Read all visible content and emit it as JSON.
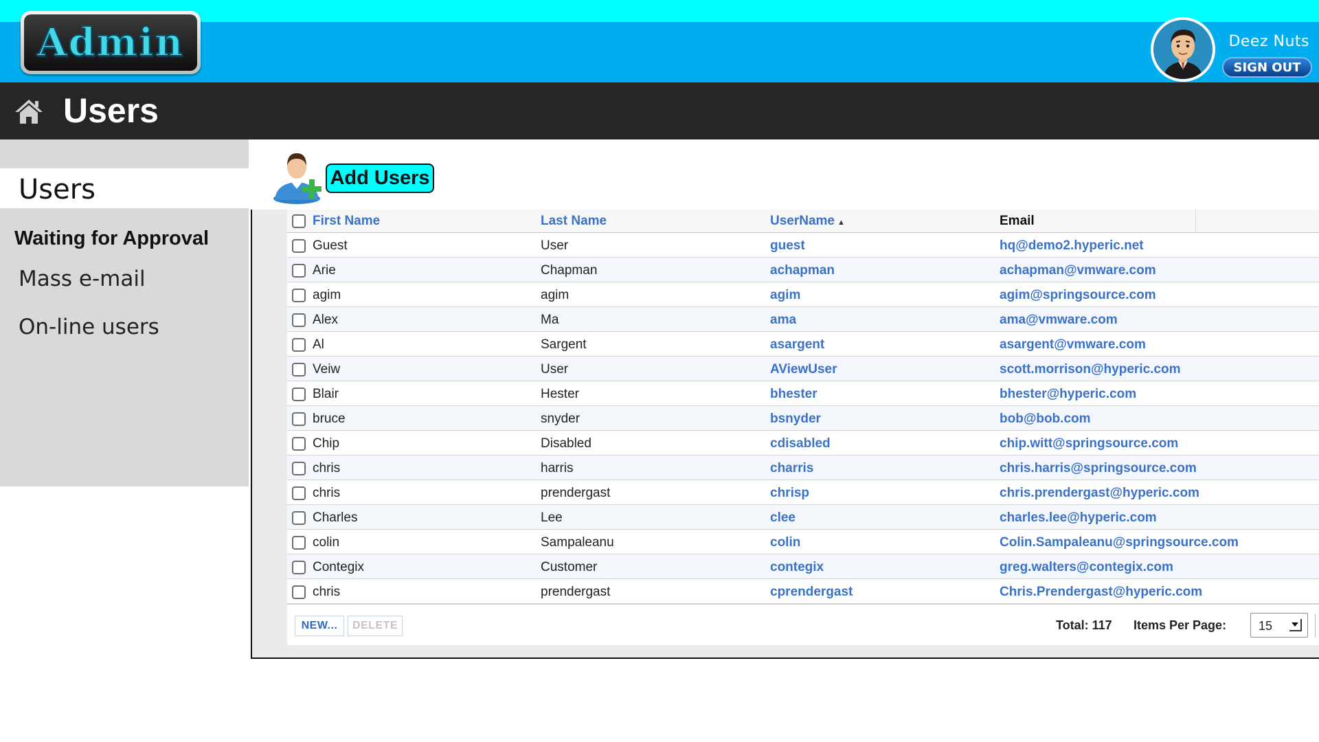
{
  "header": {
    "logo_text": "Admin",
    "user_name": "Deez Nuts",
    "signout_label": "SIGN OUT"
  },
  "title_bar": {
    "home_icon": "home-icon",
    "title": "Users"
  },
  "sidebar": {
    "active_item": "Users",
    "items": [
      {
        "label": "Waiting for Approval"
      },
      {
        "label": "Mass e-mail"
      },
      {
        "label": "On-line users"
      }
    ]
  },
  "toolbar": {
    "add_users_icon": "add-user-icon",
    "add_users_label": "Add Users"
  },
  "table": {
    "columns": {
      "first_name": "First Name",
      "last_name": "Last Name",
      "username": "UserName",
      "email": "Email"
    },
    "sort_indicator": "▲",
    "rows": [
      {
        "first": "Guest",
        "last": "User",
        "username": "guest",
        "email": "hq@demo2.hyperic.net"
      },
      {
        "first": "Arie",
        "last": "Chapman",
        "username": "achapman",
        "email": "achapman@vmware.com"
      },
      {
        "first": "agim",
        "last": "agim",
        "username": "agim",
        "email": "agim@springsource.com"
      },
      {
        "first": "Alex",
        "last": "Ma",
        "username": "ama",
        "email": "ama@vmware.com"
      },
      {
        "first": "Al",
        "last": "Sargent",
        "username": "asargent",
        "email": "asargent@vmware.com"
      },
      {
        "first": "Veiw",
        "last": "User",
        "username": "AViewUser",
        "email": "scott.morrison@hyperic.com"
      },
      {
        "first": "Blair",
        "last": "Hester",
        "username": "bhester",
        "email": "bhester@hyperic.com"
      },
      {
        "first": "bruce",
        "last": "snyder",
        "username": "bsnyder",
        "email": "bob@bob.com"
      },
      {
        "first": "Chip",
        "last": "Disabled",
        "username": "cdisabled",
        "email": "chip.witt@springsource.com"
      },
      {
        "first": "chris",
        "last": "harris",
        "username": "charris",
        "email": "chris.harris@springsource.com"
      },
      {
        "first": "chris",
        "last": "prendergast",
        "username": "chrisp",
        "email": "chris.prendergast@hyperic.com"
      },
      {
        "first": "Charles",
        "last": "Lee",
        "username": "clee",
        "email": "charles.lee@hyperic.com"
      },
      {
        "first": "colin",
        "last": "Sampaleanu",
        "username": "colin",
        "email": "Colin.Sampaleanu@springsource.com"
      },
      {
        "first": "Contegix",
        "last": "Customer",
        "username": "contegix",
        "email": "greg.walters@contegix.com"
      },
      {
        "first": "chris",
        "last": "prendergast",
        "username": "cprendergast",
        "email": "Chris.Prendergast@hyperic.com"
      }
    ]
  },
  "footer": {
    "new_label": "NEW...",
    "delete_label": "DELETE",
    "total_label": "Total: 117",
    "items_per_page_label": "Items Per Page:",
    "items_per_page_value": "15"
  },
  "colors": {
    "top_strip": "#00ffff",
    "header": "#00aeef",
    "title_bar": "#262626",
    "sidebar": "#d9d9d9",
    "link_blue": "#3a72c8",
    "add_button": "#00ffff"
  }
}
